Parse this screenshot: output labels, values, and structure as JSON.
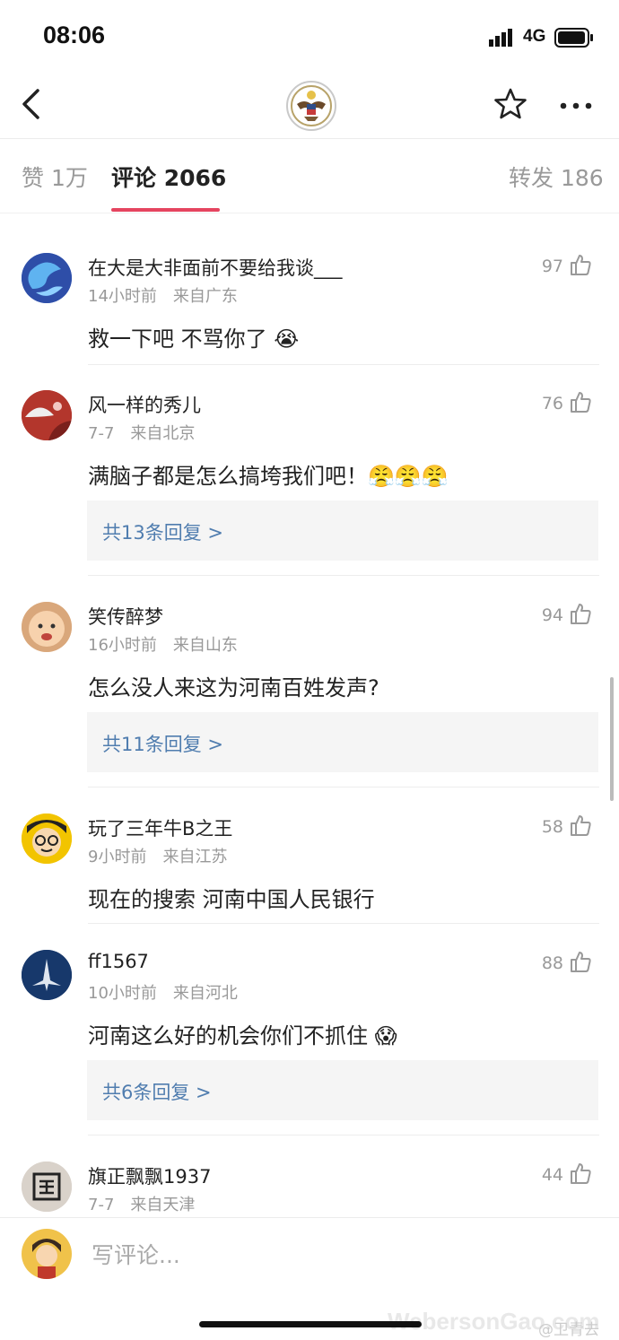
{
  "status_bar": {
    "time": "08:06",
    "network": "4G"
  },
  "tabs": [
    {
      "label": "赞 1万",
      "active": false
    },
    {
      "label": "评论 2066",
      "active": true
    },
    {
      "label": "转发 186",
      "active": false
    }
  ],
  "comments": [
    {
      "user": "在大是大非面前不要给我谈___",
      "time": "14小时前",
      "location": "来自广东",
      "likes": "97",
      "text": "救一下吧 不骂你了 😭",
      "reply": null
    },
    {
      "user": "风一样的秀儿",
      "time": "7-7",
      "location": "来自北京",
      "likes": "76",
      "text": "满脑子都是怎么搞垮我们吧！😤😤😤",
      "reply": "共13条回复 >"
    },
    {
      "user": "笑传醉梦",
      "time": "16小时前",
      "location": "来自山东",
      "likes": "94",
      "text": "怎么没人来这为河南百姓发声?",
      "reply": "共11条回复 >"
    },
    {
      "user": "玩了三年牛B之王",
      "time": "9小时前",
      "location": "来自江苏",
      "likes": "58",
      "text": "现在的搜索 河南中国人民银行",
      "reply": null
    },
    {
      "user": "ff1567",
      "time": "10小时前",
      "location": "来自河北",
      "likes": "88",
      "text": "河南这么好的机会你们不抓住 😱",
      "reply": "共6条回复 >"
    },
    {
      "user": "旗正飘飘1937",
      "time": "7-7",
      "location": "来自天津",
      "likes": "44",
      "text": "",
      "reply": null
    }
  ],
  "composer": {
    "placeholder": "写评论..."
  },
  "watermark": {
    "site": "WebersonGao.com",
    "handle": "@卫青去"
  },
  "colors": {
    "accent": "#e5445f",
    "link": "#507daf"
  }
}
